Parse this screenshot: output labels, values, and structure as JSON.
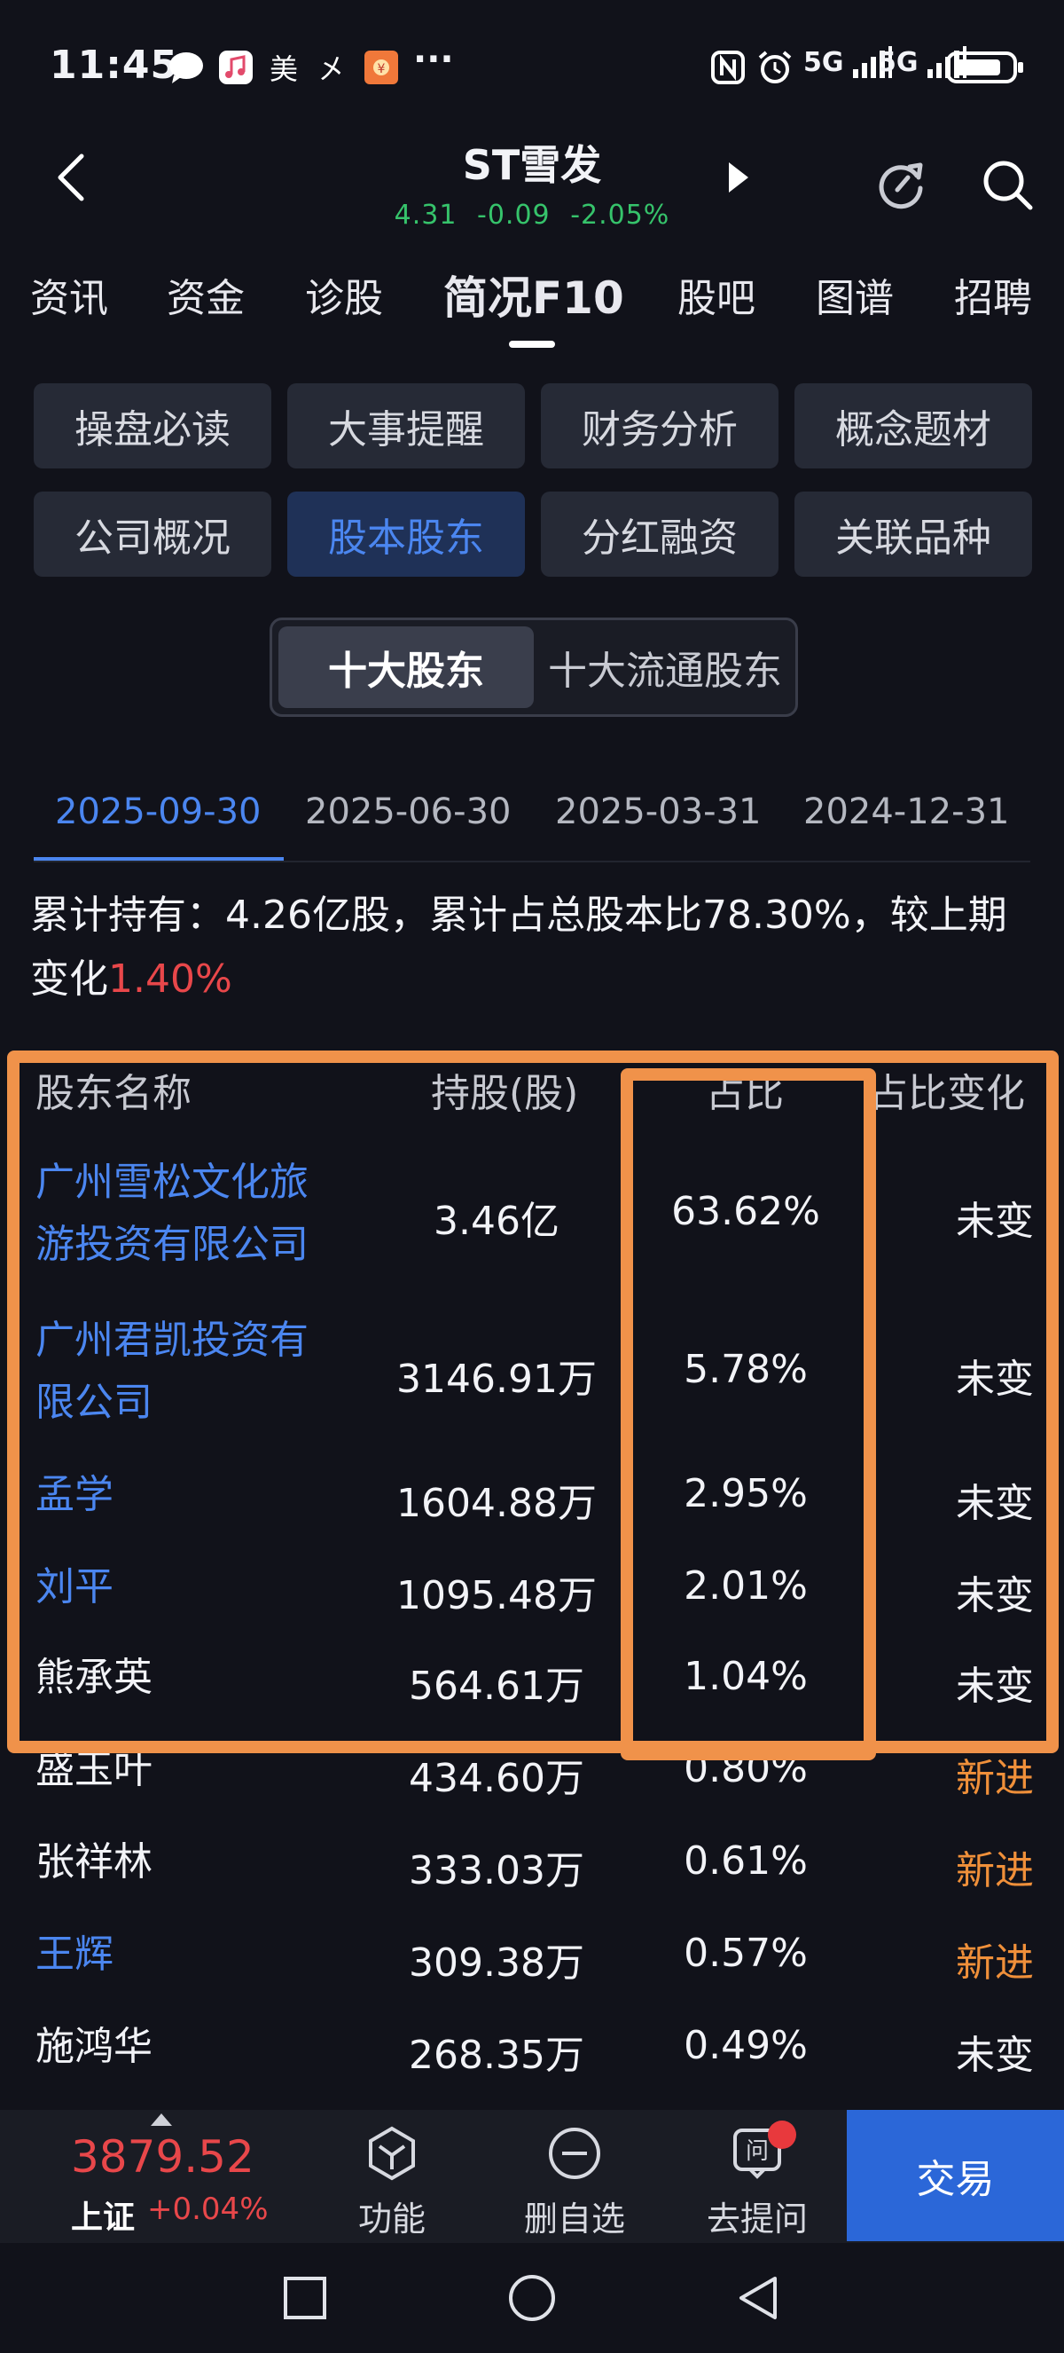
{
  "status": {
    "time": "11:45",
    "more_dots": "···",
    "network1": "5G",
    "network2": "5G"
  },
  "header": {
    "title": "ST雪发",
    "price": "4.31",
    "change": "-0.09",
    "change_pct": "-2.05%",
    "quote_color": "#36c36b"
  },
  "tabs": [
    "资讯",
    "资金",
    "诊股",
    "简况F10",
    "股吧",
    "图谱",
    "招聘"
  ],
  "grid_buttons": [
    "操盘必读",
    "大事提醒",
    "财务分析",
    "概念题材",
    "公司概况",
    "股本股东",
    "分红融资",
    "关联品种"
  ],
  "segment": {
    "a": "十大股东",
    "b": "十大流通股东"
  },
  "dates": [
    "2025-09-30",
    "2025-06-30",
    "2025-03-31",
    "2024-12-31"
  ],
  "summary": {
    "text": "累计持有：4.26亿股，累计占总股本比78.30%，较上期变化",
    "change": "1.40%"
  },
  "table": {
    "headers": [
      "股东名称",
      "持股(股)",
      "占比",
      "占比变化"
    ],
    "rows": [
      {
        "name_line1": "广州雪松文化旅",
        "name_line2": "游投资有限公司",
        "shares": "3.46亿",
        "ratio": "63.62%",
        "change": "未变"
      },
      {
        "name_line1": "广州君凯投资有",
        "name_line2": "限公司",
        "shares": "3146.91万",
        "ratio": "5.78%",
        "change": "未变"
      },
      {
        "name": "孟学",
        "shares": "1604.88万",
        "ratio": "2.95%",
        "change": "未变"
      },
      {
        "name": "刘平",
        "shares": "1095.48万",
        "ratio": "2.01%",
        "change": "未变"
      },
      {
        "name": "熊承英",
        "shares": "564.61万",
        "ratio": "1.04%",
        "change": "未变"
      },
      {
        "name": "盛玉叶",
        "shares": "434.60万",
        "ratio": "0.80%",
        "change": "新进"
      },
      {
        "name": "张祥林",
        "shares": "333.03万",
        "ratio": "0.61%",
        "change": "新进"
      },
      {
        "name": "王辉",
        "shares": "309.38万",
        "ratio": "0.57%",
        "change": "新进"
      },
      {
        "name": "施鸿华",
        "shares": "268.35万",
        "ratio": "0.49%",
        "change": "未变"
      }
    ]
  },
  "bottom": {
    "index_value": "3879.52",
    "index_name": "上证",
    "index_change": "+0.04%",
    "items": [
      "功能",
      "删自选",
      "去提问"
    ],
    "trade": "交易"
  },
  "colors": {
    "link_blue": "#4b86f0",
    "up_red": "#e8474a",
    "new_orange": "#f0903a",
    "annotation_orange": "#f0924a"
  }
}
